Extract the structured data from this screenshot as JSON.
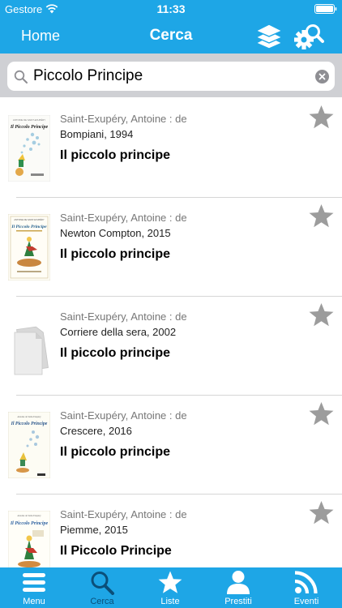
{
  "status_bar": {
    "carrier": "Gestore",
    "time": "11:33"
  },
  "nav": {
    "home_label": "Home",
    "title": "Cerca",
    "layers_icon": "layers-icon",
    "config_icon": "search-settings-icon"
  },
  "search": {
    "value": "Piccolo Principe",
    "icon": "search-icon",
    "clear_icon": "clear-icon"
  },
  "results": [
    {
      "author": "Saint-Exupéry, Antoine : de",
      "publisher": "Bompiani, 1994",
      "title": "Il piccolo principe",
      "cover_text": "Il Piccolo Principe",
      "cover_top_text": "ANTOINE DE SAINT-EXUPÉRY",
      "favorite": false
    },
    {
      "author": "Saint-Exupéry, Antoine : de",
      "publisher": "Newton Compton, 2015",
      "title": "Il piccolo principe",
      "cover_text": "Il Piccolo Principe",
      "cover_top_text": "ANTOINE DE SAINT-EXUPÉRY",
      "favorite": false
    },
    {
      "author": "Saint-Exupéry, Antoine : de",
      "publisher": "Corriere della sera, 2002",
      "title": "Il piccolo principe",
      "cover_text": "",
      "cover_top_text": "",
      "favorite": false
    },
    {
      "author": "Saint-Exupéry, Antoine : de",
      "publisher": "Crescere, 2016",
      "title": "Il piccolo principe",
      "cover_text": "Il Piccolo Principe",
      "cover_top_text": "Antoine de Saint-Exupéry",
      "favorite": false
    },
    {
      "author": "Saint-Exupéry, Antoine : de",
      "publisher": "Piemme, 2015",
      "title": "Il Piccolo Principe",
      "cover_text": "Il Piccolo Principe",
      "cover_top_text": "Antoine de Saint-Exupéry",
      "favorite": false
    }
  ],
  "tabs": [
    {
      "label": "Menu",
      "icon": "menu-icon",
      "active": false
    },
    {
      "label": "Cerca",
      "icon": "search-icon",
      "active": true
    },
    {
      "label": "Liste",
      "icon": "star-icon",
      "active": false
    },
    {
      "label": "Prestiti",
      "icon": "user-icon",
      "active": false
    },
    {
      "label": "Eventi",
      "icon": "rss-icon",
      "active": false
    }
  ],
  "colors": {
    "primary": "#1ea6e6",
    "active_tab": "#0b4f79",
    "star": "#9c9c9c",
    "search_bg": "#cfd0d4"
  }
}
